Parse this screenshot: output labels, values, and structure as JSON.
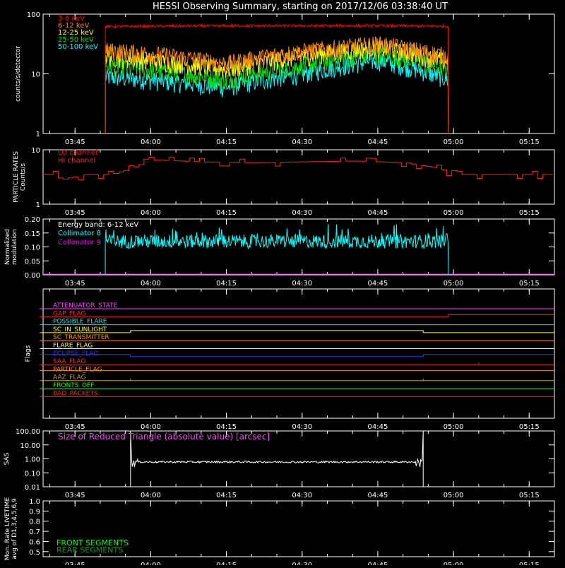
{
  "title": "HESSI Observing Summary, starting on 2017/12/06 03:38:40 UT",
  "time_axis": {
    "start": "03:38:40",
    "end": "05:20:00",
    "ticks": [
      "03:45",
      "04:00",
      "04:15",
      "04:30",
      "04:45",
      "05:00",
      "05:15"
    ],
    "tick_minutes": [
      225,
      240,
      255,
      270,
      285,
      300,
      315
    ],
    "start_minute": 218.67,
    "end_minute": 320
  },
  "chart_data": [
    {
      "type": "line",
      "panel": "lightcurves",
      "ylabel": "counts/s/detector",
      "yscale": "log",
      "ylim": [
        1,
        100
      ],
      "ytick_labels": [
        "1",
        "10",
        "100"
      ],
      "ytick_values": [
        1,
        10,
        100
      ],
      "data_window": [
        "03:51",
        "04:59"
      ],
      "series": [
        {
          "name": "3-6 keV",
          "color": "#ff0000",
          "x": [
            "03:51",
            "04:00",
            "04:15",
            "04:30",
            "04:45",
            "04:59"
          ],
          "values": [
            62,
            63,
            64,
            64,
            64,
            63
          ]
        },
        {
          "name": "6-12 keV",
          "color": "#ff8c00",
          "x": [
            "03:51",
            "04:00",
            "04:15",
            "04:30",
            "04:45",
            "04:59"
          ],
          "values": [
            25,
            22,
            15,
            24,
            32,
            20
          ]
        },
        {
          "name": "12-25 keV",
          "color": "#ffff00",
          "x": [
            "03:51",
            "04:00",
            "04:15",
            "04:30",
            "04:45",
            "04:59"
          ],
          "values": [
            20,
            17,
            12,
            20,
            28,
            16
          ]
        },
        {
          "name": "25-50 keV",
          "color": "#00e000",
          "x": [
            "03:51",
            "04:00",
            "04:15",
            "04:30",
            "04:45",
            "04:59"
          ],
          "values": [
            14,
            12,
            8,
            14,
            22,
            12
          ]
        },
        {
          "name": "50-100 keV",
          "color": "#00ffff",
          "x": [
            "03:51",
            "04:00",
            "04:15",
            "04:30",
            "04:45",
            "04:59"
          ],
          "values": [
            9,
            8,
            6,
            10,
            17,
            8
          ]
        }
      ]
    },
    {
      "type": "line",
      "panel": "particle",
      "ylabel": "PARTICLE RATES",
      "ylabel2": "Counts/s",
      "yscale": "log",
      "ylim": [
        1,
        10
      ],
      "ytick_labels": [
        "1",
        "10"
      ],
      "ytick_values": [
        1,
        10
      ],
      "series": [
        {
          "name": "LO channel",
          "color": "#ff0000",
          "x": [],
          "values": []
        },
        {
          "name": "HI channel",
          "color": "#ff2020",
          "x": [
            "03:38",
            "03:41",
            "03:42",
            "03:47",
            "03:52",
            "03:56",
            "04:00",
            "04:10",
            "04:20",
            "04:30",
            "04:40",
            "04:50",
            "04:57",
            "05:00",
            "05:20"
          ],
          "values": [
            3.5,
            3.5,
            2.8,
            3.5,
            3.5,
            4.5,
            6.5,
            6.0,
            5.8,
            6.0,
            6.2,
            5.8,
            4.5,
            3.5,
            3.5
          ]
        }
      ]
    },
    {
      "type": "line",
      "panel": "modulation",
      "ylabel": "Normalized",
      "ylabel2": "modulation",
      "ylim": [
        0,
        0.2
      ],
      "ytick_labels": [
        "0.00",
        "0.05",
        "0.10",
        "0.15",
        "0.20"
      ],
      "ytick_values": [
        0,
        0.05,
        0.1,
        0.15,
        0.2
      ],
      "annotation": "Energy band: 6-12 keV",
      "series": [
        {
          "name": "Collimator 8",
          "color": "#00ffff",
          "x": [
            "03:51",
            "04:15",
            "04:30",
            "04:59"
          ],
          "values": [
            0.12,
            0.12,
            0.12,
            0.12
          ]
        },
        {
          "name": "Collimator 9",
          "color": "#ff00ff",
          "x": [
            "03:38",
            "05:20"
          ],
          "values": [
            0.0,
            0.0
          ]
        }
      ]
    },
    {
      "type": "line",
      "panel": "flags",
      "ylabel": "Flags",
      "series": [
        {
          "name": "ATTENUATOR_STATE",
          "color": "#ff40ff",
          "x": [
            "03:38",
            "05:20"
          ],
          "values": [
            0,
            0
          ]
        },
        {
          "name": "GAP_FLAG",
          "color": "#ff2020",
          "x": [
            "03:38",
            "04:59",
            "04:59",
            "05:20"
          ],
          "values": [
            0,
            0,
            1,
            1
          ]
        },
        {
          "name": "POSSIBLE_FLARE",
          "color": "#00e5e5",
          "x": [
            "03:38",
            "05:20"
          ],
          "values": [
            0,
            0
          ]
        },
        {
          "name": "SC_IN_SUNLIGHT",
          "color": "#ffff00",
          "x": [
            "03:38",
            "03:56",
            "03:56",
            "04:54",
            "04:54",
            "05:20"
          ],
          "values": [
            0,
            0,
            1,
            1,
            0,
            0
          ]
        },
        {
          "name": "SC_TRANSMITTER",
          "color": "#ff8c00",
          "x": [
            "03:38",
            "05:20"
          ],
          "values": [
            0,
            0
          ]
        },
        {
          "name": "FLARE_FLAG",
          "color": "#ffff40",
          "x": [
            "03:38",
            "05:20"
          ],
          "values": [
            0,
            0
          ]
        },
        {
          "name": "ECLIPSE_FLAG",
          "color": "#3030ff",
          "x": [
            "03:38",
            "03:56",
            "03:56",
            "04:54",
            "04:54",
            "05:20"
          ],
          "values": [
            1,
            1,
            0,
            0,
            1,
            1
          ]
        },
        {
          "name": "SAA_FLAG",
          "color": "#ff2020",
          "x": [
            "03:38",
            "05:05",
            "05:05",
            "05:05",
            "05:20"
          ],
          "values": [
            0,
            0,
            1,
            0,
            0
          ]
        },
        {
          "name": "PARTICLE_FLAG",
          "color": "#ff8c00",
          "x": [
            "03:38",
            "05:20"
          ],
          "values": [
            1,
            1
          ]
        },
        {
          "name": "AAZ_FLAG",
          "color": "#c0a000",
          "x": [
            "03:38",
            "03:56",
            "03:56",
            "03:56",
            "04:54",
            "04:54",
            "04:54",
            "05:20"
          ],
          "values": [
            0,
            0,
            1,
            0,
            0,
            1,
            0,
            0
          ]
        },
        {
          "name": "FRONTS_OFF",
          "color": "#00ff00",
          "x": [
            "03:38",
            "05:20"
          ],
          "values": [
            0,
            0
          ]
        },
        {
          "name": "BAD_PACKETS",
          "color": "#ff2020",
          "x": [
            "03:38",
            "05:20"
          ],
          "values": [
            0,
            0
          ]
        }
      ]
    },
    {
      "type": "line",
      "panel": "sas",
      "ylabel": "SAS",
      "yscale": "log",
      "ylim": [
        0.01,
        100
      ],
      "ytick_labels": [
        "0.01",
        "0.10",
        "1.00",
        "10.00",
        "100.00"
      ],
      "ytick_values": [
        0.01,
        0.1,
        1,
        10,
        100
      ],
      "annotation": "Size of Reduced Triangle (absolute value) [arcsec]",
      "series": [
        {
          "name": "SAS",
          "color": "#ffffff",
          "x": [
            "03:56",
            "04:00",
            "04:30",
            "04:54"
          ],
          "values": [
            0.6,
            0.6,
            0.6,
            0.6
          ]
        }
      ]
    },
    {
      "type": "line",
      "panel": "livetime",
      "ylabel": "Mon. Rate LIVETIME",
      "ylabel2": "avg of D1,3,4,5,6,9",
      "ylim": [
        0.45,
        1.0
      ],
      "ytick_labels": [
        "0.5",
        "0.6",
        "0.7",
        "0.8",
        "0.9",
        "1.0"
      ],
      "ytick_values": [
        0.5,
        0.6,
        0.7,
        0.8,
        0.9,
        1.0
      ],
      "series": [
        {
          "name": "FRONT SEGMENTS",
          "color": "#00ff00",
          "x": [],
          "values": []
        },
        {
          "name": "REAR SEGMENTS",
          "color": "#00a000",
          "x": [],
          "values": []
        }
      ]
    }
  ]
}
